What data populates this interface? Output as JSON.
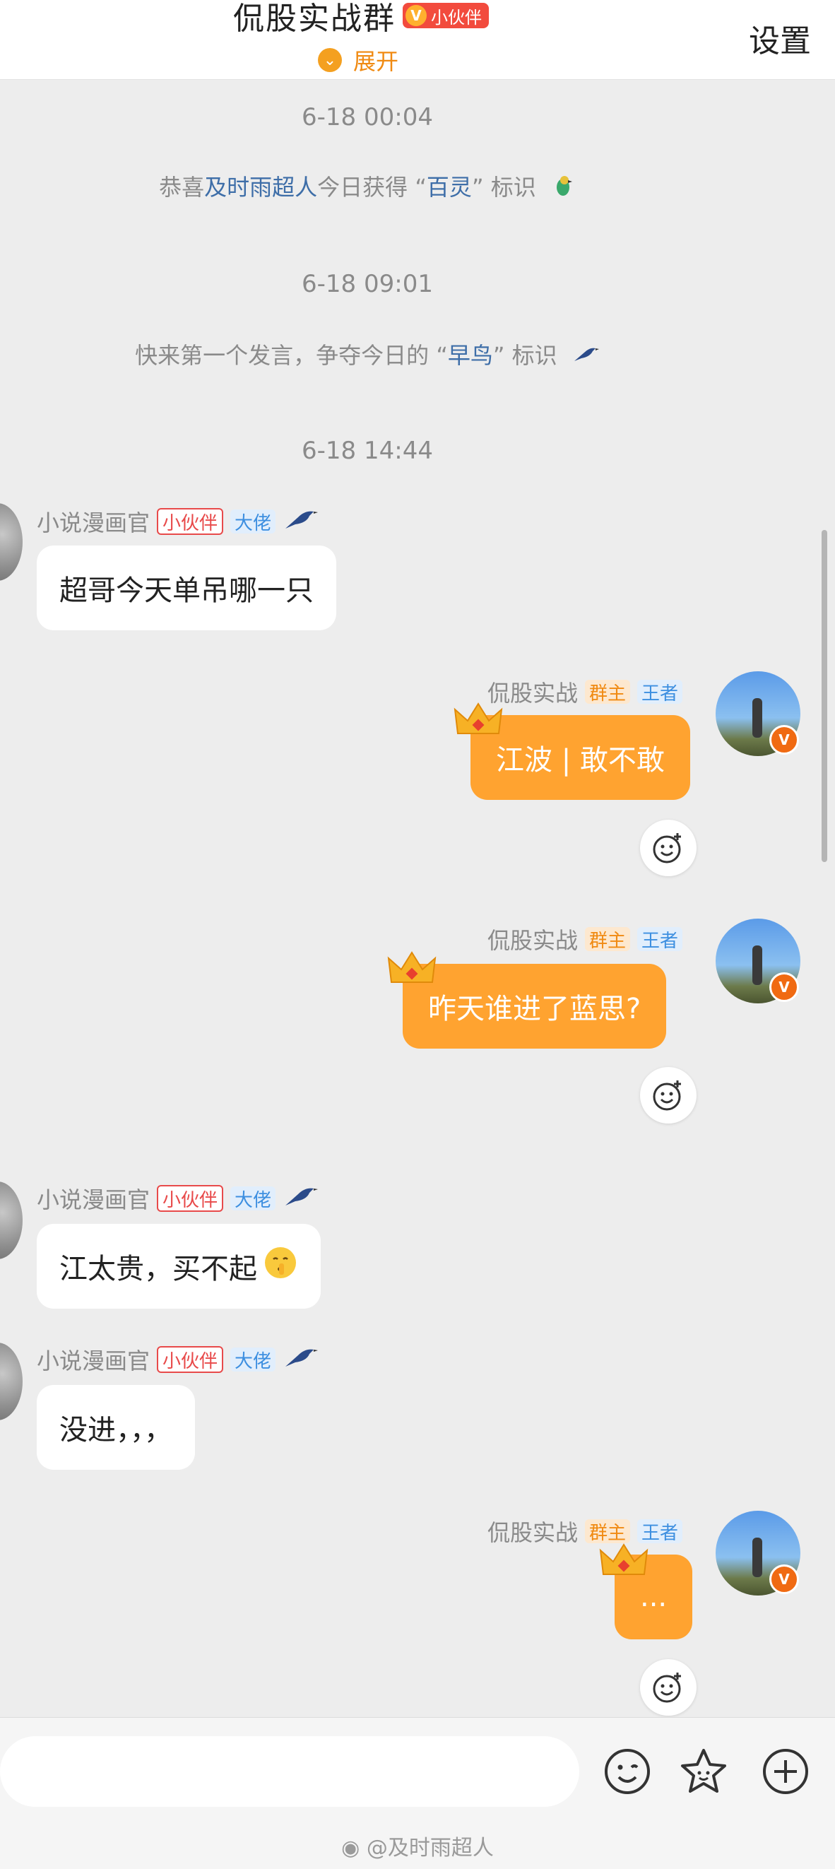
{
  "header": {
    "group_name": "侃股实战群",
    "badge_label": "小伙伴",
    "expand_label": "展开",
    "settings_label": "设置"
  },
  "messages_feed": {
    "time1": "6-18 00:04",
    "sys1": {
      "pre": "恭喜",
      "user": "及时雨超人",
      "mid": "今日获得 “",
      "badge": "百灵",
      "post": "” 标识"
    },
    "time2": "6-18 09:01",
    "sys2": {
      "pre": "快来第一个发言，争夺今日的 “",
      "badge": "早鸟",
      "post": "” 标识"
    },
    "time3": "6-18 14:44"
  },
  "users": {
    "member": {
      "name": "小说漫画官",
      "tag1": "小伙伴",
      "tag2": "大佬"
    },
    "owner": {
      "name": "侃股实战",
      "tag1": "群主",
      "tag2": "王者"
    }
  },
  "messages": [
    {
      "from": "member",
      "text": "超哥今天单吊哪一只"
    },
    {
      "from": "owner",
      "text": "江波 | 敢不敢"
    },
    {
      "from": "owner",
      "text": "昨天谁进了蓝思?"
    },
    {
      "from": "member",
      "text": "江太贵，买不起"
    },
    {
      "from": "member",
      "text": "没进，，，"
    },
    {
      "from": "owner",
      "text": "..."
    }
  ],
  "footer": {
    "watermark": "@及时雨超人"
  },
  "icons": {
    "emoji": "smiley-icon",
    "sticker": "star-sticker-icon",
    "plus": "plus-icon",
    "crown": "crown-icon",
    "bird": "bird-icon"
  },
  "colors": {
    "accent_orange": "#ffa330",
    "header_orange": "#f08a12",
    "highlight_blue": "#3e6ea8",
    "badge_red": "#f24b3d"
  }
}
